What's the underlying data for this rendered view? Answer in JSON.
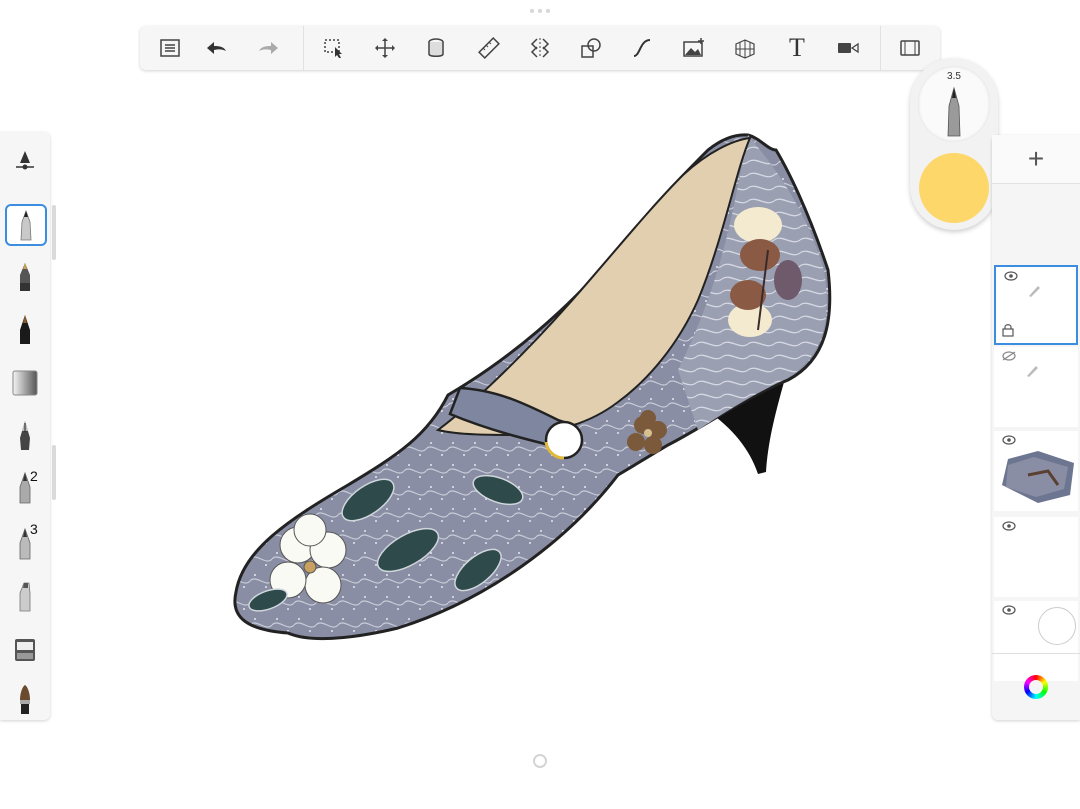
{
  "toolbar": {
    "items": [
      {
        "name": "layers-menu-icon"
      },
      {
        "name": "undo-icon"
      },
      {
        "name": "redo-icon"
      },
      {
        "name": "selection-icon"
      },
      {
        "name": "transform-icon"
      },
      {
        "name": "fill-icon"
      },
      {
        "name": "ruler-icon"
      },
      {
        "name": "symmetry-icon"
      },
      {
        "name": "shape-icon"
      },
      {
        "name": "curve-icon"
      },
      {
        "name": "import-image-icon"
      },
      {
        "name": "perspective-icon"
      },
      {
        "name": "text-tool-icon"
      },
      {
        "name": "time-lapse-icon"
      },
      {
        "name": "fullscreen-icon"
      }
    ],
    "text_tool_label": "T"
  },
  "brushes": {
    "tools": [
      {
        "name": "brush-settings-icon"
      },
      {
        "name": "pencil-brush-icon",
        "selected": true
      },
      {
        "name": "marker-brush-icon"
      },
      {
        "name": "ink-pen-brush-icon"
      },
      {
        "name": "eraser-brush-icon"
      },
      {
        "name": "fountain-pen-brush-icon"
      },
      {
        "name": "airbrush-brush-icon",
        "badge": "2"
      },
      {
        "name": "fineliner-brush-icon",
        "badge": "3"
      },
      {
        "name": "chisel-brush-icon"
      },
      {
        "name": "paint-bucket-brush-icon"
      },
      {
        "name": "paintbrush-brush-icon"
      }
    ]
  },
  "puck": {
    "size": "3.5",
    "color": "#FED76B"
  },
  "layers": {
    "add_label": "+",
    "items": [
      {
        "name": "layer-1",
        "visible": true,
        "active": true,
        "locked": true
      },
      {
        "name": "layer-2",
        "visible": false,
        "active": false
      },
      {
        "name": "layer-3",
        "visible": true,
        "active": false
      },
      {
        "name": "layer-4",
        "visible": true,
        "active": false
      },
      {
        "name": "background-layer",
        "visible": true,
        "active": false
      }
    ]
  },
  "colors": {
    "accent": "#3B8DE0",
    "shoe_fabric": "#8A8EA4",
    "shoe_lining": "#E2CFB0",
    "heel": "#111111"
  }
}
